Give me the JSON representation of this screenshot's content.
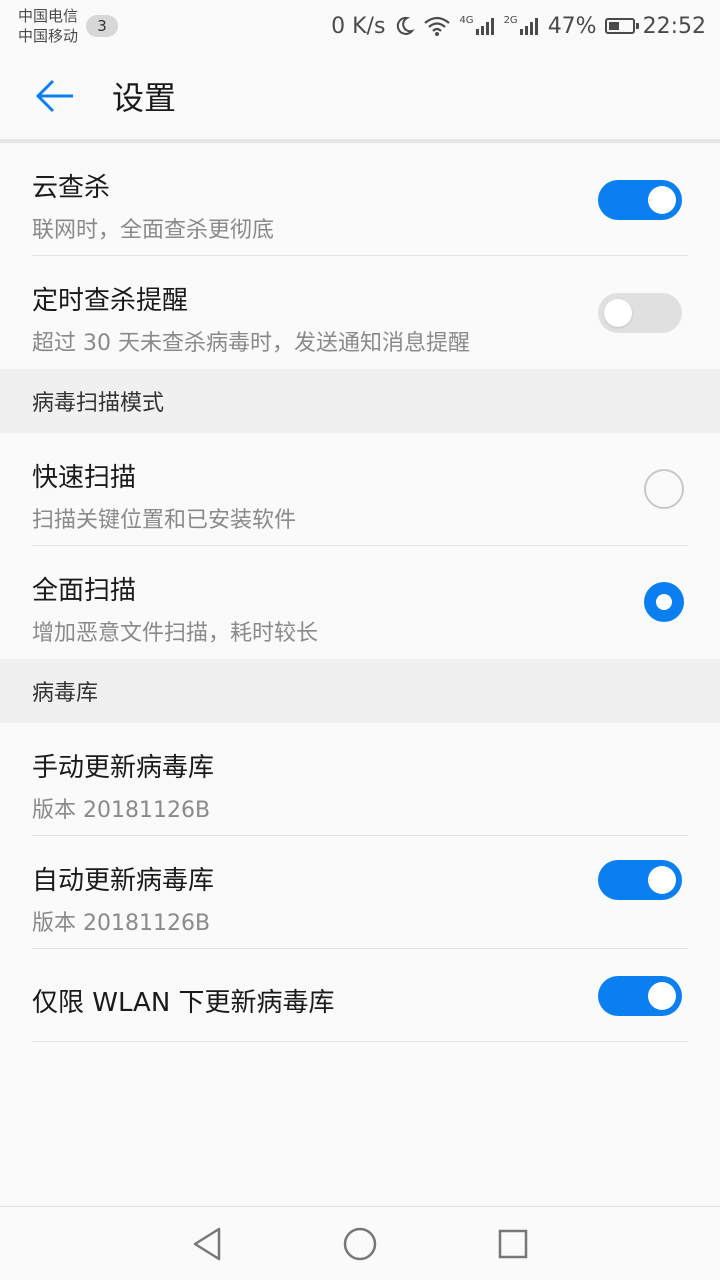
{
  "status_bar": {
    "carrier1": "中国电信",
    "carrier2": "中国移动",
    "notification_count": "3",
    "net_speed": "0 K/s",
    "net1": "4G",
    "net2": "2G",
    "battery_percent": "47%",
    "battery_level": 0.47,
    "time": "22:52"
  },
  "header": {
    "title": "设置"
  },
  "settings": {
    "cloud_scan": {
      "title": "云查杀",
      "subtitle": "联网时，全面查杀更彻底",
      "enabled": true
    },
    "scheduled_reminder": {
      "title": "定时查杀提醒",
      "subtitle": "超过 30 天未查杀病毒时，发送通知消息提醒",
      "enabled": false
    }
  },
  "scan_mode": {
    "header": "病毒扫描模式",
    "options": [
      {
        "title": "快速扫描",
        "subtitle": "扫描关键位置和已安装软件",
        "selected": false
      },
      {
        "title": "全面扫描",
        "subtitle": "增加恶意文件扫描，耗时较长",
        "selected": true
      }
    ]
  },
  "virus_db": {
    "header": "病毒库",
    "manual_update": {
      "title": "手动更新病毒库",
      "subtitle": "版本 20181126B"
    },
    "auto_update": {
      "title": "自动更新病毒库",
      "subtitle": "版本 20181126B",
      "enabled": true
    },
    "wlan_only": {
      "title": "仅限 WLAN 下更新病毒库",
      "enabled": true
    }
  },
  "colors": {
    "accent": "#0a7ff0",
    "section_bg": "#f0f0f0",
    "subtitle": "#8a8a8a"
  },
  "nav": {
    "back_icon": "triangle-back-icon",
    "home_icon": "circle-home-icon",
    "recents_icon": "square-recents-icon"
  }
}
